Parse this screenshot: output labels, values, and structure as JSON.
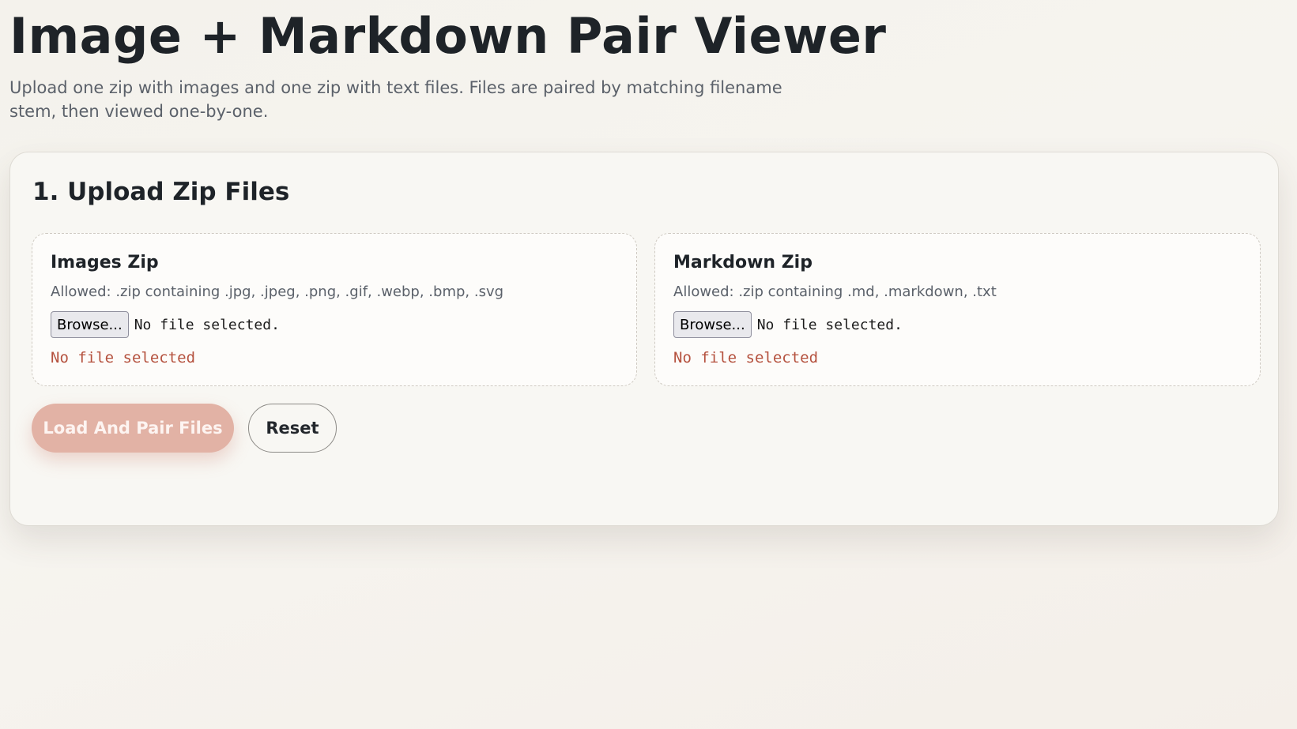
{
  "header": {
    "title": "Image + Markdown Pair Viewer",
    "subtitle": "Upload one zip with images and one zip with text files. Files are paired by matching filename stem, then viewed one-by-one."
  },
  "upload_section": {
    "title": "1. Upload Zip Files",
    "images_box": {
      "title": "Images Zip",
      "allowed": "Allowed: .zip containing .jpg, .jpeg, .png, .gif, .webp, .bmp, .svg",
      "browse_label": "Browse...",
      "file_name": "No file selected.",
      "status": "No file selected"
    },
    "markdown_box": {
      "title": "Markdown Zip",
      "allowed": "Allowed: .zip containing .md, .markdown, .txt",
      "browse_label": "Browse...",
      "file_name": "No file selected.",
      "status": "No file selected"
    },
    "actions": {
      "load_label": "Load And Pair Files",
      "reset_label": "Reset"
    }
  },
  "colors": {
    "background": "#f5f3ee",
    "card": "#f8f7f3",
    "primary_button": "#e2b2a5",
    "status_text": "#b5523f",
    "heading": "#1e2328",
    "muted_text": "#5b616a"
  }
}
